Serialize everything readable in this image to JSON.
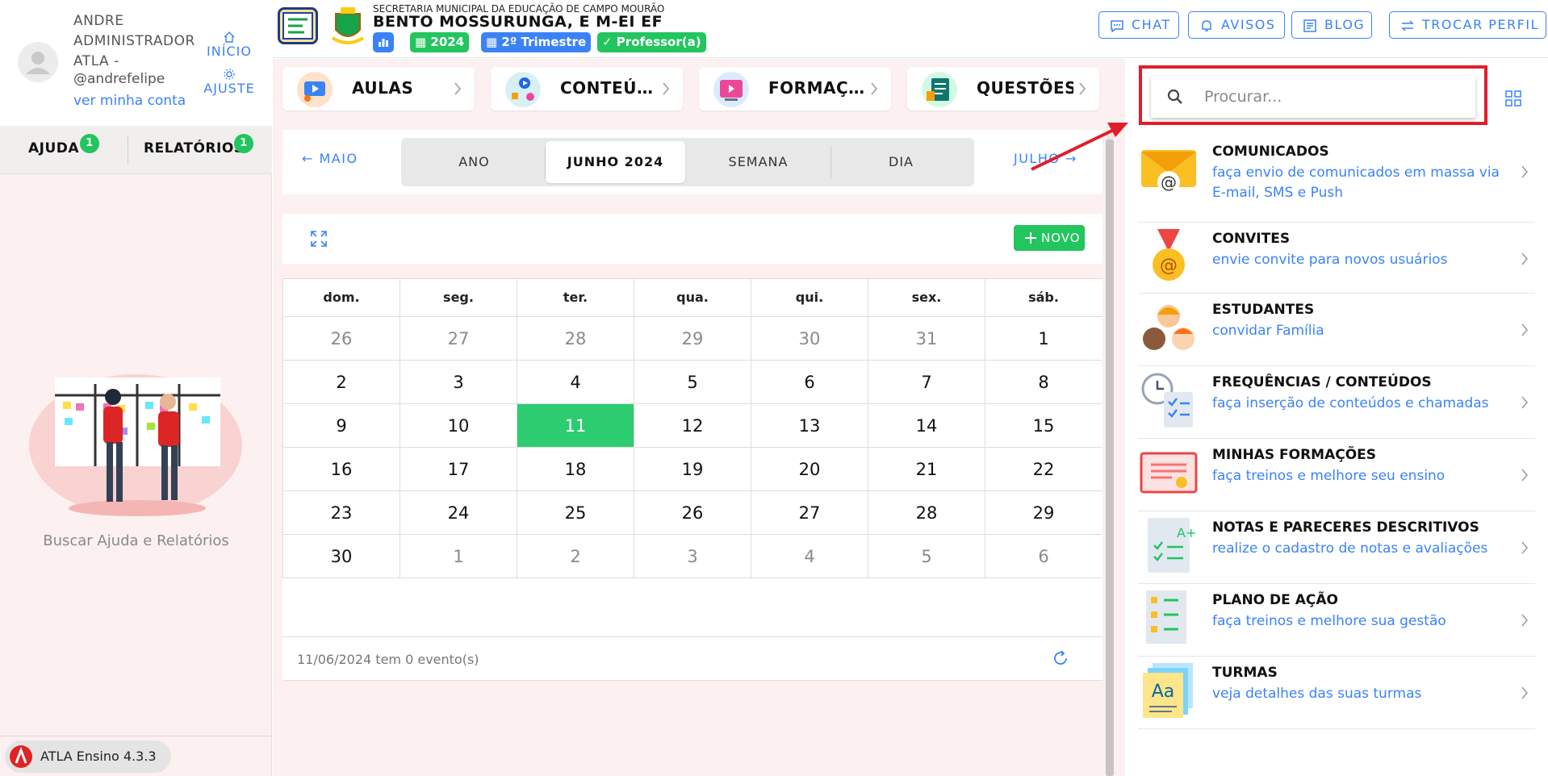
{
  "user": {
    "name": "ANDRE ADMINISTRADOR ATLA -",
    "handle": "@andrefelipe",
    "account_link": "ver minha conta",
    "nav_home": "INÍCIO",
    "nav_settings": "AJUSTE"
  },
  "help_tabs": {
    "help_label": "AJUDA",
    "help_count": "1",
    "reports_label": "RELATÓRIOS",
    "reports_count": "1",
    "caption": "Buscar Ajuda e Relatórios"
  },
  "version": "ATLA Ensino 4.3.3",
  "header": {
    "org": "SECRETARIA MUNICIPAL DA EDUCAÇÃO DE CAMPO MOURÃO",
    "school": "BENTO MOSSURUNGA, E M-EI EF",
    "year": "2024",
    "term": "2º Trimestre",
    "role": "Professor(a)",
    "buttons": {
      "chat": "CHAT",
      "alerts": "AVISOS",
      "blog": "BLOG",
      "profile": "TROCAR PERFIL"
    }
  },
  "categories": [
    {
      "label": "AULAS",
      "icon": "video-class-icon"
    },
    {
      "label": "CONTEÚ…",
      "icon": "content-icon"
    },
    {
      "label": "FORMAÇ…",
      "icon": "training-icon"
    },
    {
      "label": "QUESTÕES",
      "icon": "questions-icon"
    }
  ],
  "calendar_nav": {
    "prev": "MAIO",
    "next": "JULHO",
    "views": [
      "ANO",
      "JUNHO 2024",
      "SEMANA",
      "DIA"
    ],
    "active_view": "JUNHO 2024"
  },
  "toolbar": {
    "new_label": "NOVO"
  },
  "calendar": {
    "weekdays": [
      "dom.",
      "seg.",
      "ter.",
      "qua.",
      "qui.",
      "sex.",
      "sáb."
    ],
    "weeks": [
      [
        {
          "d": "26",
          "m": true
        },
        {
          "d": "27",
          "m": true
        },
        {
          "d": "28",
          "m": true
        },
        {
          "d": "29",
          "m": true
        },
        {
          "d": "30",
          "m": true
        },
        {
          "d": "31",
          "m": true
        },
        {
          "d": "1"
        }
      ],
      [
        {
          "d": "2"
        },
        {
          "d": "3"
        },
        {
          "d": "4"
        },
        {
          "d": "5"
        },
        {
          "d": "6"
        },
        {
          "d": "7"
        },
        {
          "d": "8"
        }
      ],
      [
        {
          "d": "9"
        },
        {
          "d": "10"
        },
        {
          "d": "11",
          "today": true
        },
        {
          "d": "12"
        },
        {
          "d": "13"
        },
        {
          "d": "14"
        },
        {
          "d": "15"
        }
      ],
      [
        {
          "d": "16"
        },
        {
          "d": "17"
        },
        {
          "d": "18"
        },
        {
          "d": "19"
        },
        {
          "d": "20"
        },
        {
          "d": "21"
        },
        {
          "d": "22"
        }
      ],
      [
        {
          "d": "23"
        },
        {
          "d": "24"
        },
        {
          "d": "25"
        },
        {
          "d": "26"
        },
        {
          "d": "27"
        },
        {
          "d": "28"
        },
        {
          "d": "29"
        }
      ],
      [
        {
          "d": "30"
        },
        {
          "d": "1",
          "m": true
        },
        {
          "d": "2",
          "m": true
        },
        {
          "d": "3",
          "m": true
        },
        {
          "d": "4",
          "m": true
        },
        {
          "d": "5",
          "m": true
        },
        {
          "d": "6",
          "m": true
        }
      ]
    ],
    "footer": "11/06/2024 tem 0 evento(s)"
  },
  "search": {
    "placeholder": "Procurar..."
  },
  "quick_links": [
    {
      "title": "COMUNICADOS",
      "desc": "faça envio de comunicados em massa via E-mail, SMS e Push",
      "icon": "email-icon"
    },
    {
      "title": "CONVITES",
      "desc": "envie convite para novos usuários",
      "icon": "medal-icon"
    },
    {
      "title": "ESTUDANTES",
      "desc": "convidar Família",
      "icon": "students-icon"
    },
    {
      "title": "FREQUÊNCIAS / CONTEÚDOS",
      "desc": "faça inserção de conteúdos e chamadas",
      "icon": "attendance-icon"
    },
    {
      "title": "MINHAS FORMAÇÕES",
      "desc": "faça treinos e melhore seu ensino",
      "icon": "certificate-icon"
    },
    {
      "title": "NOTAS E PARECERES DESCRITIVOS",
      "desc": "realize o cadastro de notas e avaliações",
      "icon": "grades-icon"
    },
    {
      "title": "PLANO DE AÇÃO",
      "desc": "faça treinos e melhore sua gestão",
      "icon": "action-plan-icon"
    },
    {
      "title": "TURMAS",
      "desc": "veja detalhes das suas turmas",
      "icon": "classes-icon"
    }
  ],
  "colors": {
    "accent": "#3b82f6",
    "success": "#22c55e",
    "today": "#2ecc71",
    "highlight": "#e11d2a"
  }
}
